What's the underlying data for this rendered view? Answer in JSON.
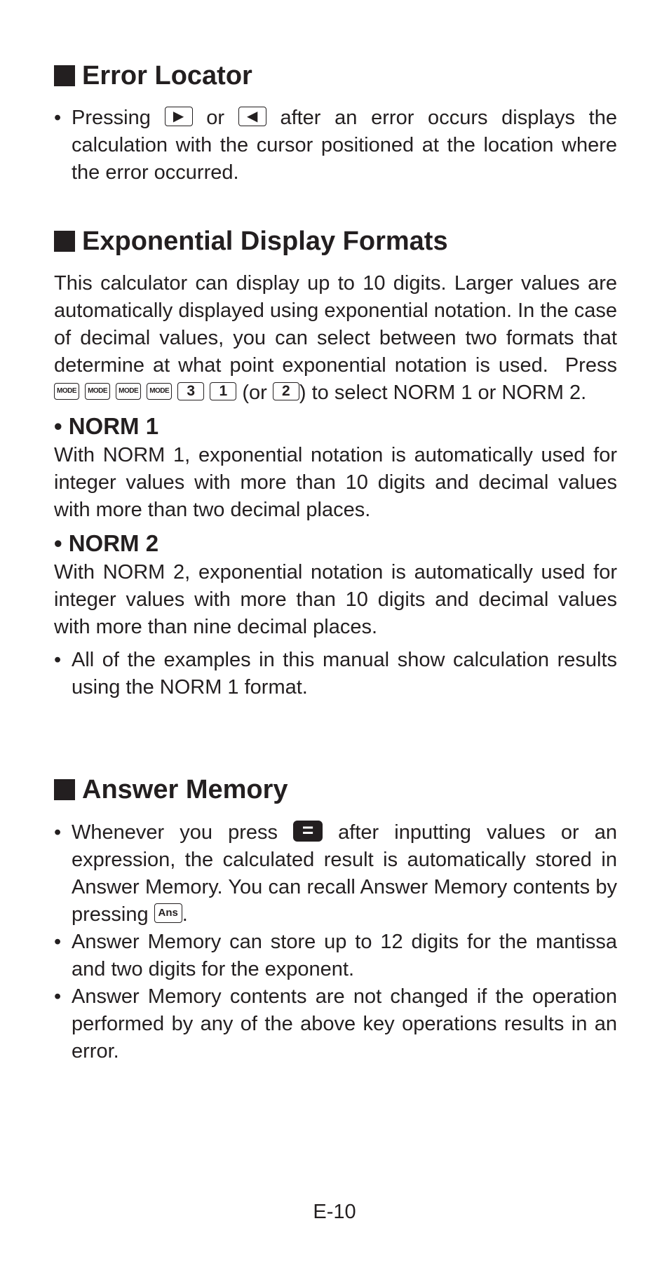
{
  "sections": {
    "error_locator": {
      "title": "Error Locator",
      "bullet": {
        "before": "Pressing",
        "key_right": "▶",
        "mid": "or",
        "key_left": "◀",
        "after": "after an error occurs displays the calculation with the cursor positioned at the location where the error occurred."
      }
    },
    "exponential": {
      "title": "Exponential Display Formats",
      "intro": "This calculator can display up to 10 digits. Larger values are automatically displayed using exponential notation. In the case of decimal values, you can select between two formats that determine at what point exponential notation is used.",
      "press": "Press",
      "keys": [
        "MODE",
        "MODE",
        "MODE",
        "MODE",
        "3",
        "1"
      ],
      "or_open": "(or",
      "alt_key": "2",
      "close_text": ") to select NORM 1 or NORM 2.",
      "norm1": {
        "heading": "• NORM 1",
        "text": "With NORM 1, exponential notation is automatically used for integer values with more than 10 digits and decimal values with more than two decimal places."
      },
      "norm2": {
        "heading": "• NORM 2",
        "text": "With NORM 2, exponential notation is automatically used for integer values with more than 10 digits and decimal values with more than nine decimal places."
      },
      "note": "All of the examples in this manual show calculation results using the NORM 1 format."
    },
    "answer_memory": {
      "title": "Answer Memory",
      "bullet1": {
        "before": "Whenever you press",
        "eq_key": "=",
        "mid": "after inputting values or an expression, the calculated result is automatically stored in Answer Memory. You can recall Answer Memory contents by pressing",
        "ans_key": "Ans",
        "end": "."
      },
      "bullet2": "Answer Memory can store up to 12 digits for the mantissa and two digits for the exponent.",
      "bullet3": "Answer Memory contents are not changed if the operation performed by any of the above key operations results in an error."
    }
  },
  "footer": {
    "page_number": "E-10"
  }
}
